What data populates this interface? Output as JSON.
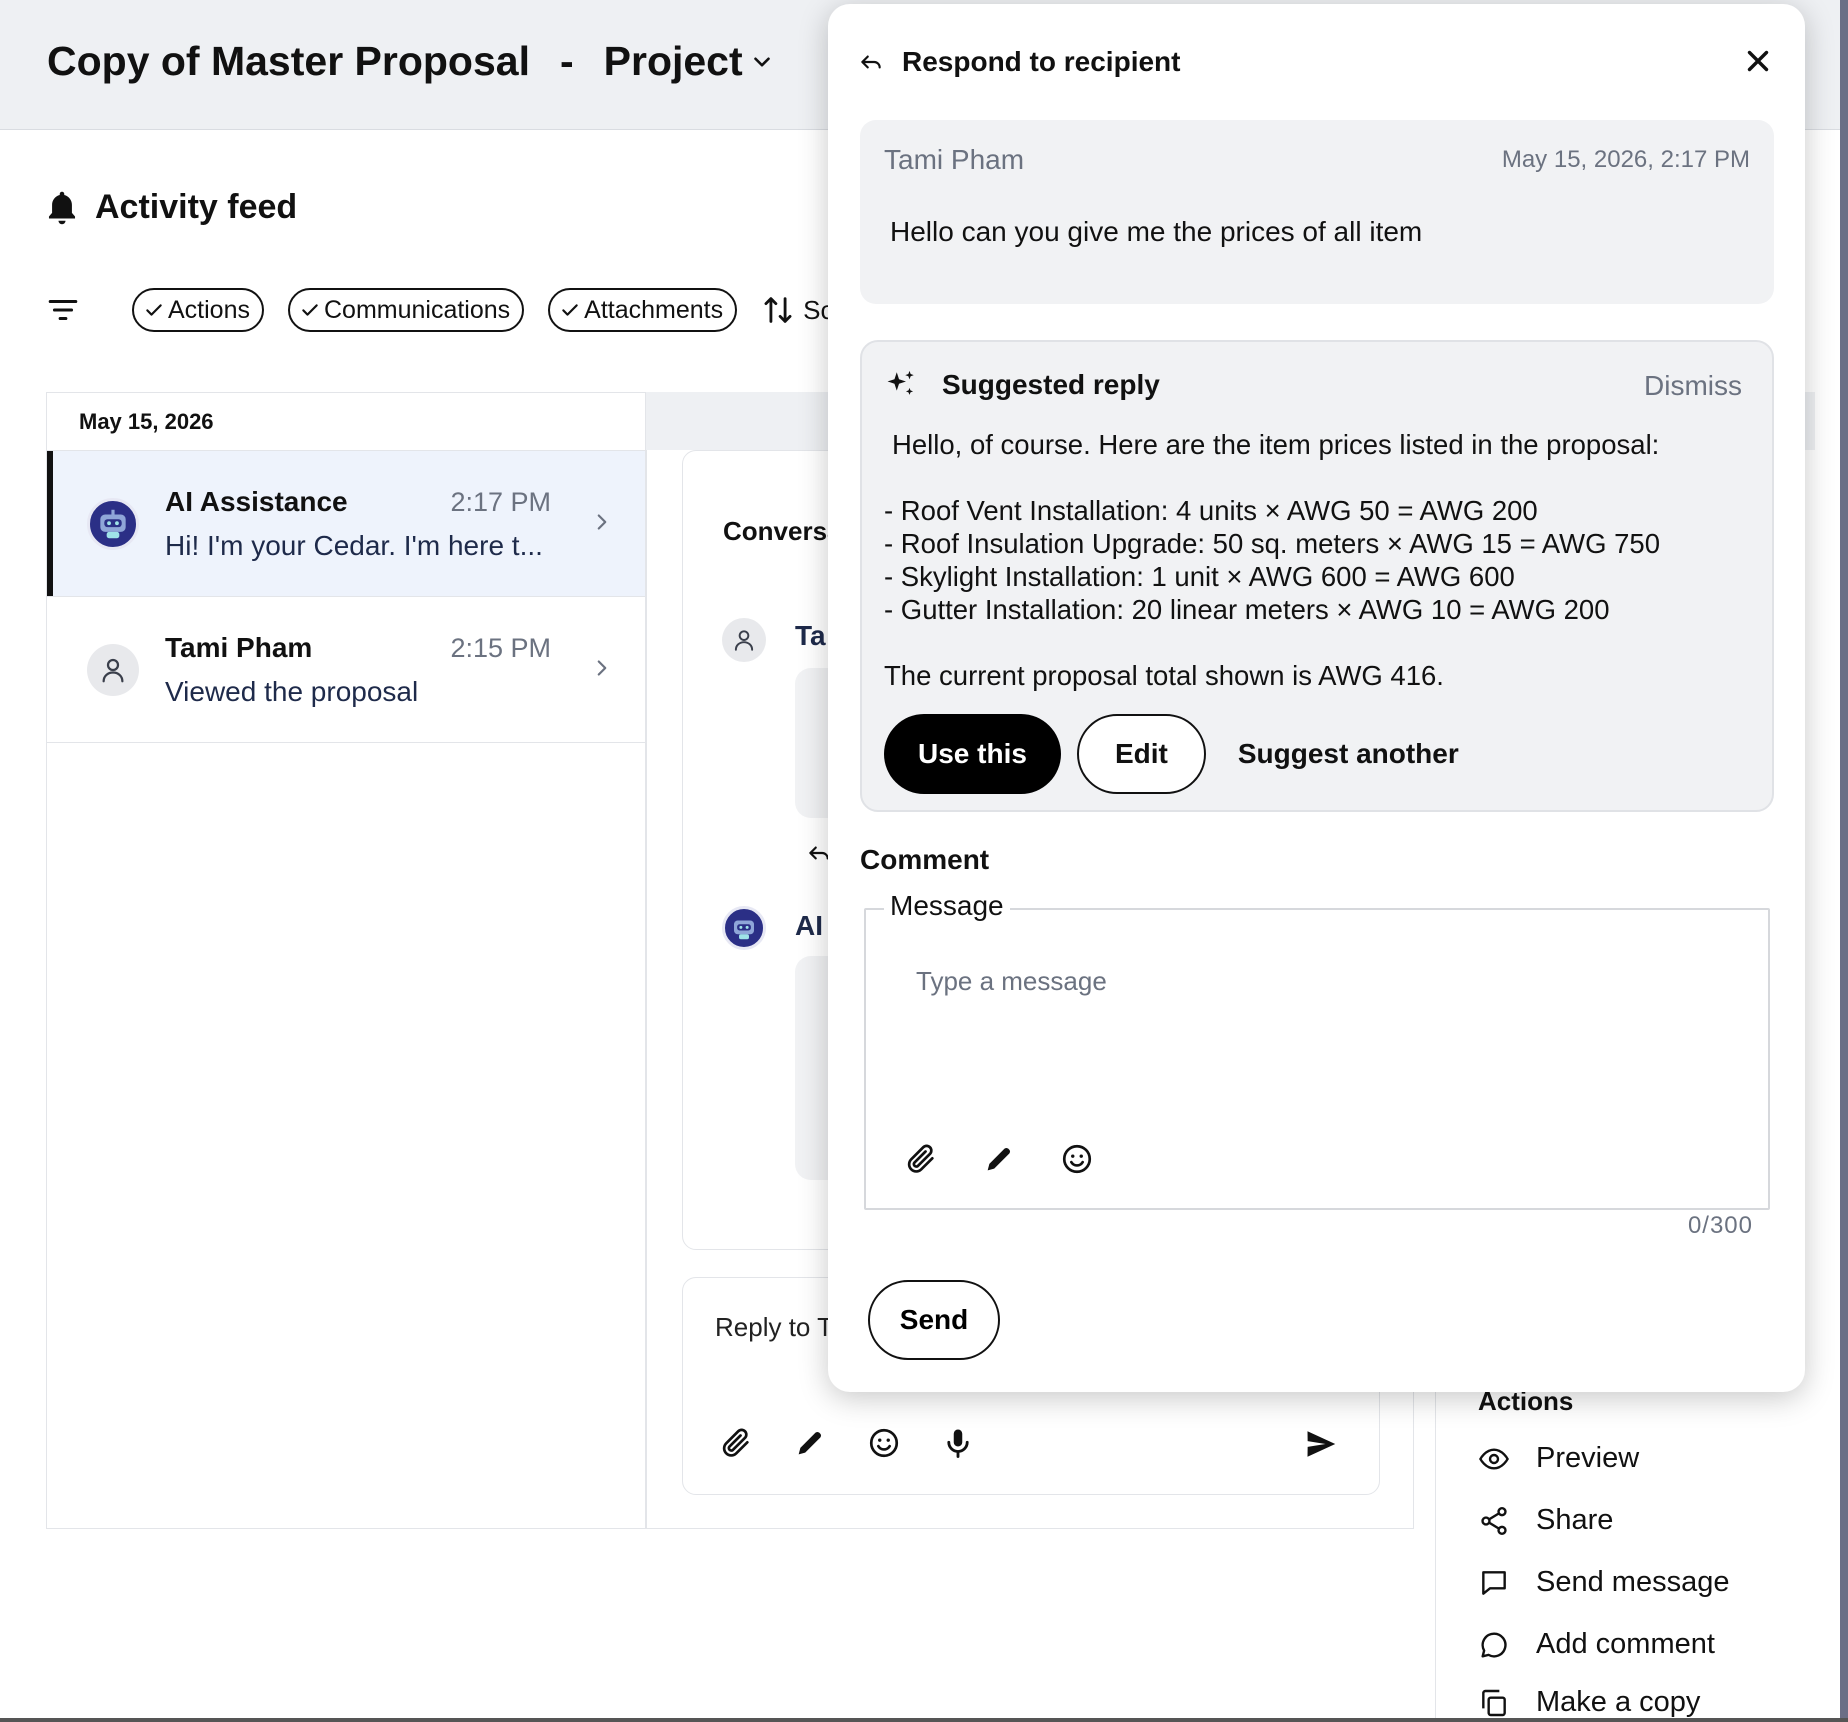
{
  "header": {
    "title": "Copy of Master Proposal",
    "separator": "-",
    "project_label": "Project"
  },
  "activity_feed": {
    "title": "Activity feed",
    "filters": [
      "Actions",
      "Communications",
      "Attachments"
    ],
    "sort_label": "Sc",
    "date_group": "May 15, 2026",
    "items": [
      {
        "name": "AI Assistance",
        "time": "2:17 PM",
        "preview": "Hi! I'm your Cedar. I'm here t..."
      },
      {
        "name": "Tami Pham",
        "time": "2:15 PM",
        "preview": "Viewed the proposal"
      }
    ]
  },
  "conversation": {
    "title": "Conversa",
    "sender1": "Ta",
    "sender2": "AI",
    "reply_placeholder": "Reply to T"
  },
  "actions": {
    "title": "Actions",
    "items": [
      "Preview",
      "Share",
      "Send message",
      "Add comment",
      "Make a copy"
    ]
  },
  "modal": {
    "title": "Respond to recipient",
    "original": {
      "sender": "Tami Pham",
      "timestamp": "May 15, 2026, 2:17 PM",
      "text": "Hello can you give me the prices of all item"
    },
    "suggested": {
      "title": "Suggested reply",
      "dismiss": "Dismiss",
      "intro": "Hello, of course. Here are the item prices listed in the proposal:",
      "lines": [
        "- Roof Vent Installation: 4 units × AWG 50 = AWG 200",
        "- Roof Insulation Upgrade: 50 sq. meters × AWG 15 = AWG 750",
        "- Skylight Installation: 1 unit × AWG 600 = AWG 600",
        "- Gutter Installation: 20 linear meters × AWG 10 = AWG 200"
      ],
      "total": "The current proposal total shown is AWG 416.",
      "use_label": "Use this",
      "edit_label": "Edit",
      "another_label": "Suggest another"
    },
    "comment": {
      "label": "Comment",
      "field_legend": "Message",
      "placeholder": "Type a message",
      "counter": "0/300"
    },
    "send_label": "Send"
  },
  "colors": {
    "topbar_bg": "#eef0f3",
    "active_item_bg": "#eef3fc",
    "bot_avatar": "#2b2f86",
    "muted_text": "#6b7280",
    "primary_button": "#000000"
  },
  "icons": {
    "title_dropdown": "chevron-down-icon",
    "feed": "bell-icon",
    "filter": "filter-icon",
    "chip_check": "check-icon",
    "sort": "sort-icon",
    "item_arrow": "chevron-right-icon",
    "user_avatar": "user-icon",
    "bot_avatar": "robot-icon",
    "attach": "paperclip-icon",
    "draw": "pencil-icon",
    "emoji": "smiley-icon",
    "voice": "microphone-icon",
    "send": "send-icon",
    "modal_back": "reply-arrow-icon",
    "close": "close-icon",
    "ai": "sparkle-icon",
    "preview": "eye-icon",
    "share": "share-icon",
    "message": "message-square-icon",
    "comment": "comment-bubble-icon",
    "copy": "copy-icon"
  }
}
